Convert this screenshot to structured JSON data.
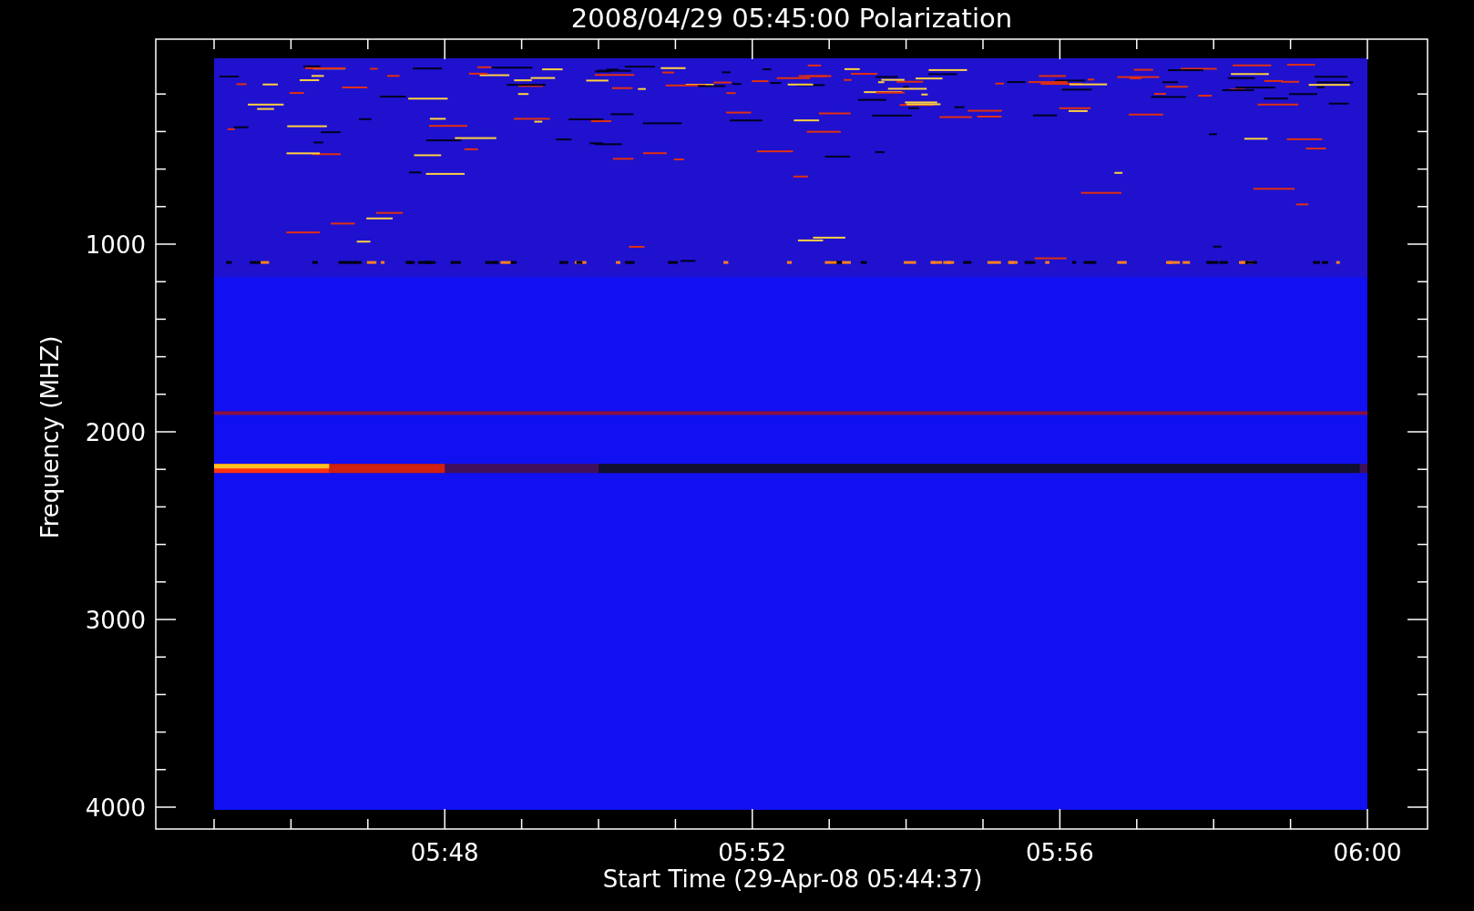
{
  "plot": {
    "title": "2008/04/29 05:45:00 Polarization",
    "ylabel": "Frequency (MHZ)",
    "xlabel": "Start Time (29-Apr-08 05:44:37)",
    "yticks": [
      "1000",
      "2000",
      "3000",
      "4000"
    ],
    "xticks": [
      "05:48",
      "05:52",
      "05:56",
      "06:00"
    ]
  }
}
